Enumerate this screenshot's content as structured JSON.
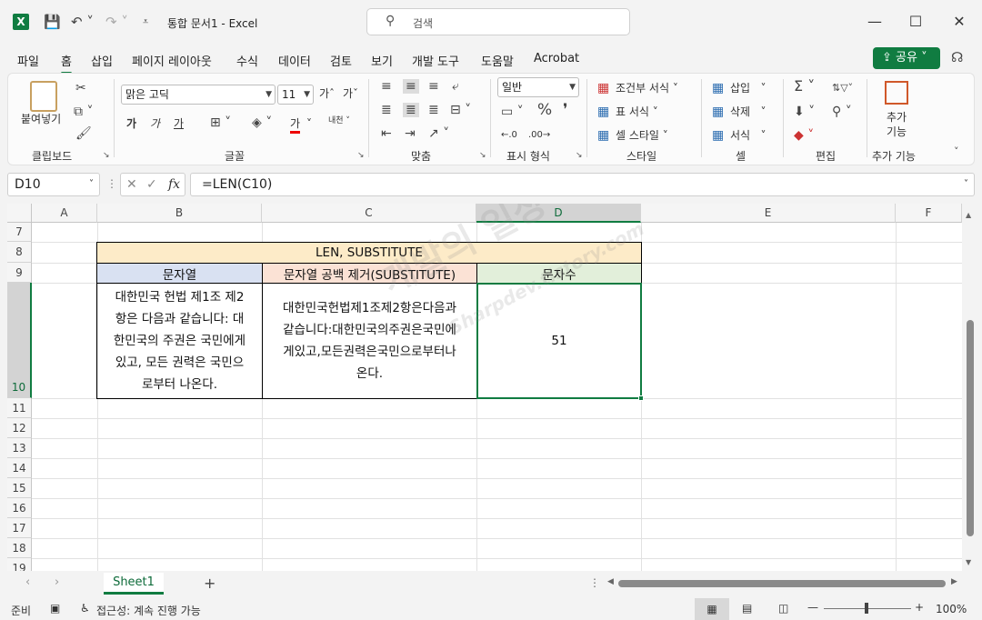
{
  "window": {
    "title": "통합 문서1  -  Excel",
    "search_placeholder": "검색"
  },
  "menu": {
    "tabs": [
      "파일",
      "홈",
      "삽입",
      "페이지 레이아웃",
      "수식",
      "데이터",
      "검토",
      "보기",
      "개발 도구",
      "도움말",
      "Acrobat"
    ],
    "active_tab": "홈",
    "share_label": "공유"
  },
  "ribbon": {
    "clipboard": {
      "paste_label": "붙여넣기",
      "group_label": "클립보드"
    },
    "font": {
      "font_name": "맑은 고딕",
      "font_size": "11",
      "group_label": "글꼴",
      "bold": "가",
      "italic": "가",
      "underline": "가",
      "font_color": "가"
    },
    "alignment": {
      "group_label": "맞춤"
    },
    "number": {
      "format": "일반",
      "group_label": "표시 형식"
    },
    "styles": {
      "conditional": "조건부 서식",
      "table": "표 서식",
      "cell_styles": "셀 스타일",
      "group_label": "스타일"
    },
    "cells": {
      "insert": "삽입",
      "delete": "삭제",
      "format": "서식",
      "group_label": "셀"
    },
    "editing": {
      "group_label": "편집"
    },
    "addins": {
      "label_line1": "추가",
      "label_line2": "기능",
      "group_label": "추가 기능"
    }
  },
  "formula_bar": {
    "name_box": "D10",
    "formula": "=LEN(C10)"
  },
  "sheet": {
    "columns": [
      "A",
      "B",
      "C",
      "D",
      "E",
      "F"
    ],
    "selected_column": "D",
    "rows": [
      "7",
      "8",
      "9",
      "10",
      "11",
      "12",
      "13",
      "14",
      "15",
      "16",
      "17",
      "18",
      "19"
    ],
    "selected_row": "10",
    "table_title": "LEN, SUBSTITUTE",
    "header_b": "문자열",
    "header_c": "문자열 공백 제거(SUBSTITUTE)",
    "header_d": "문자수",
    "b10": "대한민국 헌법 제1조 제2항은 다음과 같습니다: 대한민국의 주권은 국민에게 있고, 모든 권력은 국민으로부터 나온다.",
    "b10_lines": [
      "대한민국 헌법 제1조 제2",
      "항은 다음과 같습니다: 대",
      "한민국의 주권은 국민에게",
      "있고, 모든 권력은 국민으",
      "로부터 나온다."
    ],
    "c10_lines": [
      "대한민국헌법제1조제2항은다음과",
      "같습니다:대한민국의주권은국민에",
      "게있고,모든권력은국민으로부터나",
      "온다."
    ],
    "d10": "51",
    "colors": {
      "title_fill": "#fdebc8",
      "header_b_fill": "#d9e1f2",
      "header_c_fill": "#fbe2d5",
      "header_d_fill": "#e2efda",
      "accent": "#107c41"
    }
  },
  "watermark": {
    "line1": "개발의 일상",
    "line2": "Sharpdev.tistory.com"
  },
  "sheet_tabs": {
    "active": "Sheet1"
  },
  "status": {
    "ready": "준비",
    "accessibility": "접근성: 계속 진행 가능",
    "zoom": "100%"
  }
}
